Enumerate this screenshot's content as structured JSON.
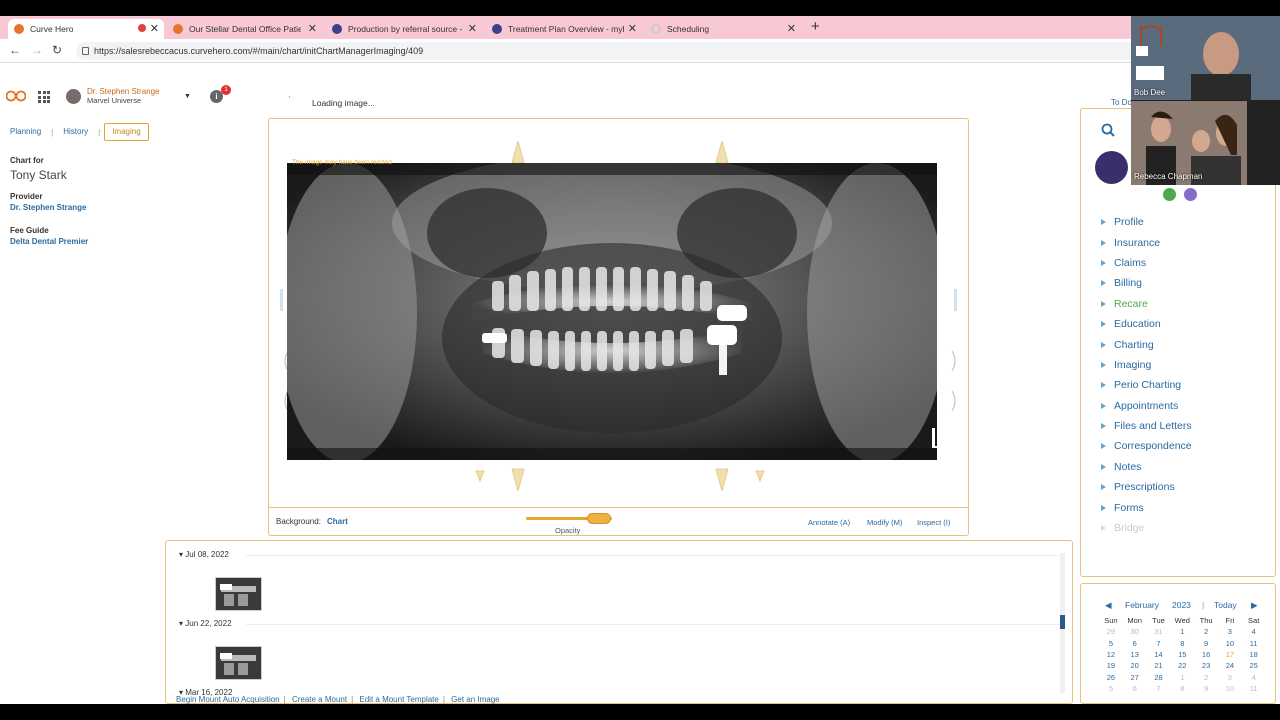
{
  "browser": {
    "tabs": [
      {
        "title": "Curve Hero",
        "active": true,
        "color": "#e8742c"
      },
      {
        "title": "Our Stellar Dental Office Patient",
        "active": false,
        "color": "#e8742c"
      },
      {
        "title": "Production by referral source - m",
        "active": false,
        "color": "#3b3f8c"
      },
      {
        "title": "Treatment Plan Overview - myPro",
        "active": false,
        "color": "#3b3f8c"
      },
      {
        "title": "Scheduling",
        "active": false,
        "color": "#cccccc"
      }
    ],
    "new_tab": "+",
    "url": "https://salesrebeccacus.curvehero.com/#/main/chart/initChartManagerImaging/409"
  },
  "header": {
    "doctor_name": "Dr. Stephen Strange",
    "org_name": "Marvel Universe",
    "notification_count": "1",
    "loading_text": "Loading image...",
    "todo_text": "To Do"
  },
  "left": {
    "tabs": [
      "Planning",
      "History",
      "Imaging"
    ],
    "selected_tab": "Imaging",
    "chart_for_label": "Chart for",
    "patient_name": "Tony Stark",
    "provider_label": "Provider",
    "provider_value": "Dr. Stephen Strange",
    "fee_guide_label": "Fee Guide",
    "fee_guide_value": "Delta Dental Premier"
  },
  "viewer": {
    "warning": "The image may have been resized",
    "background_label": "Background:",
    "background_value": "Chart",
    "opacity_label": "Opacity",
    "opacity_value": 0.85,
    "annotate": "Annotate (A)",
    "modify": "Modify (M)",
    "inspect": "Inspect (I)"
  },
  "timeline": {
    "dates": [
      "Jul 08, 2022",
      "Jun 22, 2022",
      "Mar 16, 2022"
    ],
    "links": [
      "Begin Mount Auto Acquisition",
      "Create a Mount",
      "Edit a Mount Template",
      "Get an Image"
    ]
  },
  "sidebar": {
    "items": [
      {
        "label": "Profile",
        "state": "normal"
      },
      {
        "label": "Insurance",
        "state": "normal"
      },
      {
        "label": "Claims",
        "state": "normal"
      },
      {
        "label": "Billing",
        "state": "normal"
      },
      {
        "label": "Recare",
        "state": "green"
      },
      {
        "label": "Education",
        "state": "normal"
      },
      {
        "label": "Charting",
        "state": "normal"
      },
      {
        "label": "Imaging",
        "state": "normal"
      },
      {
        "label": "Perio Charting",
        "state": "normal"
      },
      {
        "label": "Appointments",
        "state": "normal"
      },
      {
        "label": "Files and Letters",
        "state": "normal"
      },
      {
        "label": "Correspondence",
        "state": "normal"
      },
      {
        "label": "Notes",
        "state": "normal"
      },
      {
        "label": "Prescriptions",
        "state": "normal"
      },
      {
        "label": "Forms",
        "state": "normal"
      },
      {
        "label": "Bridge",
        "state": "disabled"
      }
    ]
  },
  "calendar": {
    "month": "February",
    "year": "2023",
    "today_label": "Today",
    "sep": "|",
    "weekdays": [
      "Sun",
      "Mon",
      "Tue",
      "Wed",
      "Thu",
      "Fri",
      "Sat"
    ],
    "weeks": [
      [
        "29",
        "30",
        "31",
        "1",
        "2",
        "3",
        "4"
      ],
      [
        "5",
        "6",
        "7",
        "8",
        "9",
        "10",
        "11"
      ],
      [
        "12",
        "13",
        "14",
        "15",
        "16",
        "17",
        "18"
      ],
      [
        "19",
        "20",
        "21",
        "22",
        "23",
        "24",
        "25"
      ],
      [
        "26",
        "27",
        "28",
        "1",
        "2",
        "3",
        "4"
      ],
      [
        "5",
        "6",
        "7",
        "8",
        "9",
        "10",
        "11"
      ]
    ],
    "today": "17"
  },
  "video_call": {
    "participants": [
      "Bob Dee",
      "Rebecca Chapman"
    ]
  }
}
